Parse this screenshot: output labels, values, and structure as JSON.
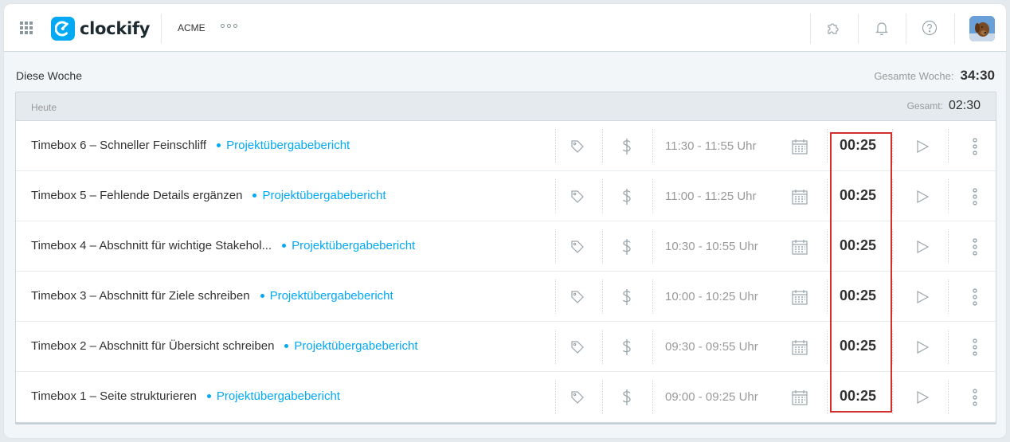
{
  "app": {
    "name": "clockify",
    "workspace": "ACME"
  },
  "icons": {
    "apps": "grid-icon",
    "logo": "clockify-logo-icon",
    "more": "more-horizontal-icon",
    "integrations": "puzzle-icon",
    "notifications": "bell-icon",
    "help": "help-circle-icon",
    "tag": "tag-icon",
    "billable": "dollar-icon",
    "calendar": "calendar-icon",
    "play": "play-icon",
    "row_menu": "more-vertical-icon"
  },
  "colors": {
    "accent": "#03a9f4",
    "highlight": "#d32f2f"
  },
  "week": {
    "label": "Diese Woche",
    "total_label": "Gesamte Woche:",
    "total": "34:30"
  },
  "day": {
    "label": "Heute",
    "total_label": "Gesamt:",
    "total": "02:30"
  },
  "entries": [
    {
      "description": "Timebox 6 – Schneller Feinschliff",
      "project": "Projektübergabebericht",
      "time_range": "11:30 - 11:55 Uhr",
      "duration": "00:25"
    },
    {
      "description": "Timebox 5 – Fehlende Details ergänzen",
      "project": "Projektübergabebericht",
      "time_range": "11:00 - 11:25 Uhr",
      "duration": "00:25"
    },
    {
      "description": "Timebox 4 – Abschnitt für wichtige Stakehol...",
      "project": "Projektübergabebericht",
      "time_range": "10:30 - 10:55 Uhr",
      "duration": "00:25"
    },
    {
      "description": "Timebox 3 – Abschnitt für Ziele schreiben",
      "project": "Projektübergabebericht",
      "time_range": "10:00 - 10:25 Uhr",
      "duration": "00:25"
    },
    {
      "description": "Timebox 2 – Abschnitt für Übersicht schreiben",
      "project": "Projektübergabebericht",
      "time_range": "09:30 - 09:55 Uhr",
      "duration": "00:25"
    },
    {
      "description": "Timebox 1 – Seite strukturieren",
      "project": "Projektübergabebericht",
      "time_range": "09:00 - 09:25 Uhr",
      "duration": "00:25"
    }
  ]
}
